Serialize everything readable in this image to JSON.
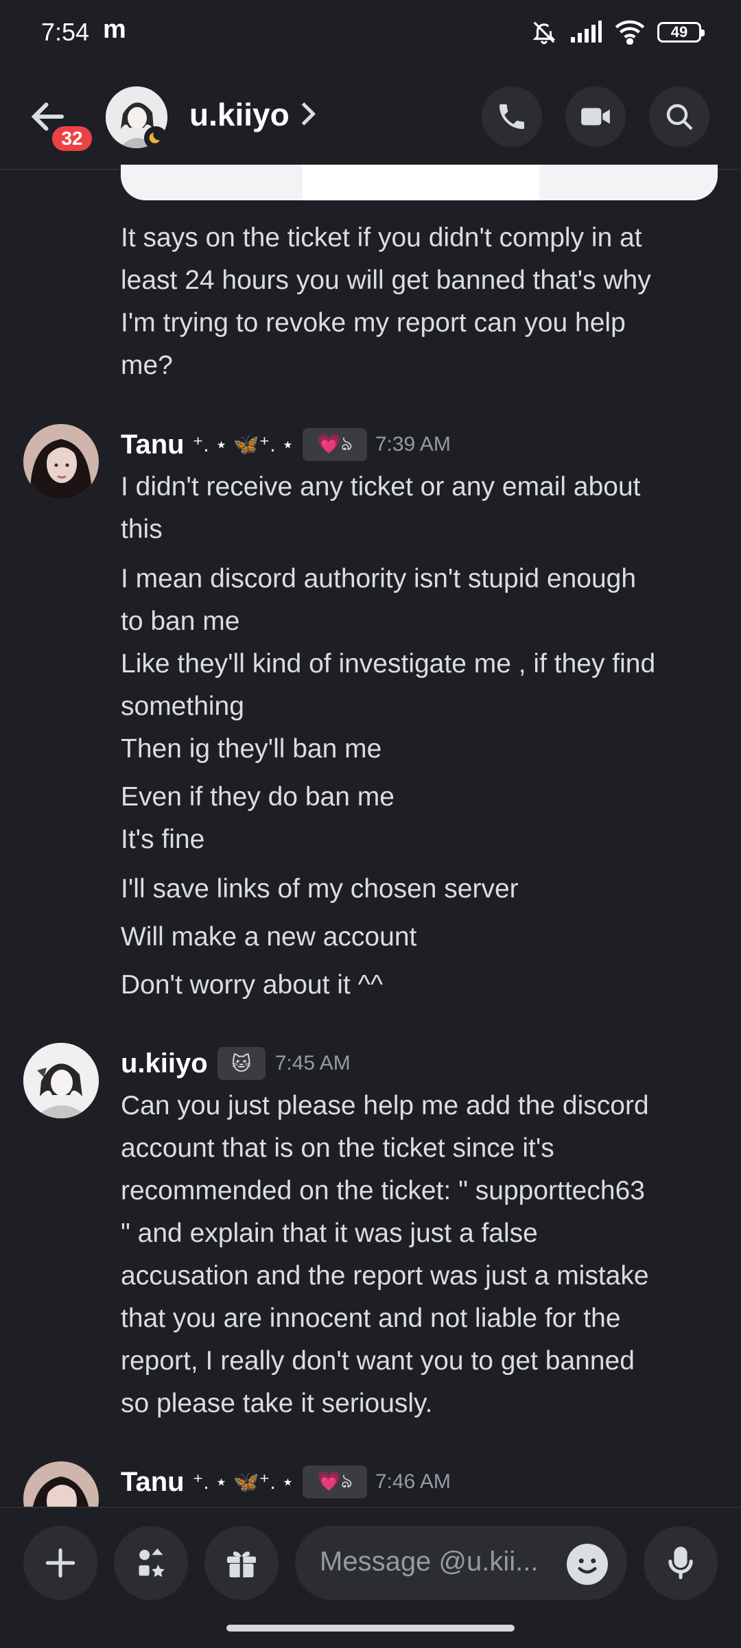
{
  "status_bar": {
    "time": "7:54",
    "carrier_glyph": "m",
    "battery": "49"
  },
  "header": {
    "title": "u.kiiyo",
    "unread_badge": "32"
  },
  "messages": [
    {
      "continuation": true,
      "lines": [
        "It says on the ticket if you didn't comply in at",
        "least 24 hours you will get banned that's why",
        "I'm trying to revoke my report can you help",
        "me?"
      ]
    },
    {
      "author": "Tanu",
      "time": "7:39 AM",
      "lines": [
        [
          "I didn't receive any ticket or any email about",
          "this"
        ],
        [
          "I mean discord authority isn't stupid enough",
          "to ban me"
        ],
        [
          "Like they'll kind of investigate me , if they find",
          "something"
        ],
        [
          "Then ig they'll ban me"
        ],
        [
          "Even if they do ban me",
          "It's fine"
        ],
        [
          "I'll save links of my chosen server"
        ],
        [
          "Will make a new account"
        ],
        [
          "Don't worry about it ^^"
        ]
      ]
    },
    {
      "author": "u.kiiyo",
      "time": "7:45 AM",
      "lines": [
        "Can you just please help me add the discord",
        "account that is on the ticket since it's",
        "recommended on the ticket: \" supporttech63",
        "\" and explain that it was just a false",
        "accusation and the report was just a mistake",
        "that you are innocent and not liable for the",
        "report, I really don't want you to get banned",
        "so please take it seriously."
      ]
    },
    {
      "author": "Tanu",
      "time": "7:46 AM"
    }
  ],
  "composer": {
    "placeholder": "Message @u.kii..."
  },
  "colors": {
    "background": "#1e1f24",
    "surface": "#2b2d31",
    "badge": "#ed4245",
    "muted": "#949ba4"
  }
}
